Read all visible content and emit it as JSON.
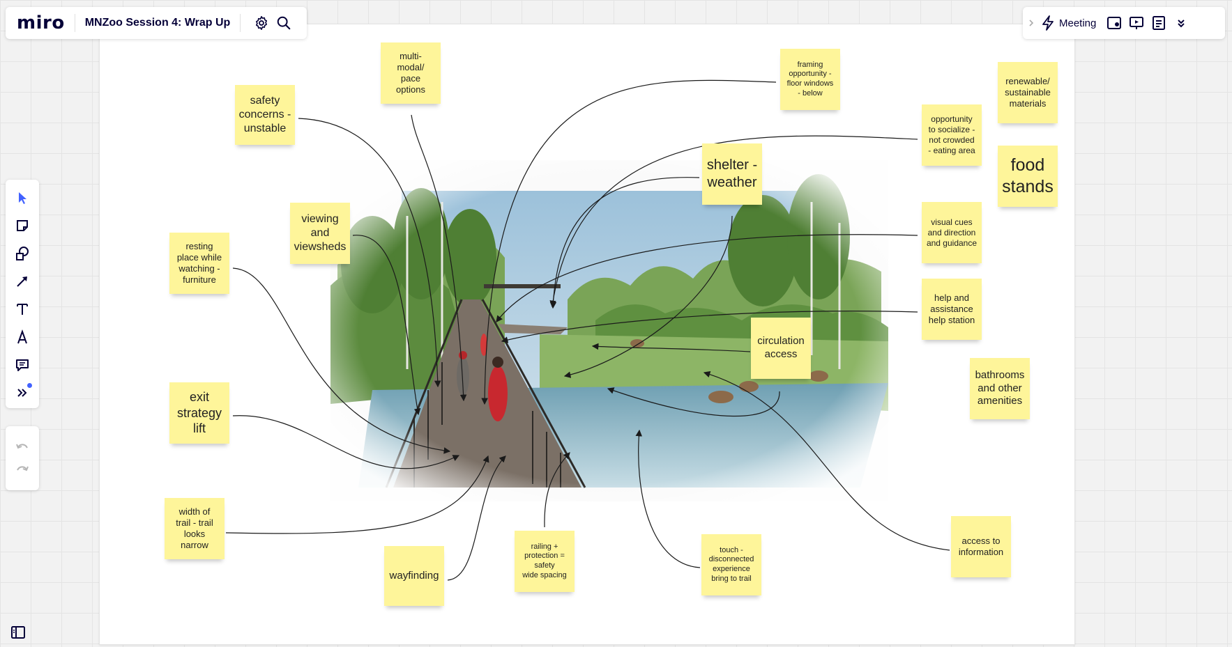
{
  "app": {
    "logo": "miro",
    "board_title": "MNZoo Session 4: Wrap Up"
  },
  "topbar": {
    "meeting_label": "Meeting"
  },
  "toolbar": {
    "tools": [
      "select-tool",
      "sticky-note-tool",
      "shapes-tool",
      "connection-line-tool",
      "text-tool",
      "pen-tool",
      "comment-tool",
      "more-tools"
    ],
    "accent": "#4262ff"
  },
  "stickies": {
    "multi_modal": "multi-\nmodal/\npace\noptions",
    "safety": "safety\nconcerns -\nunstable",
    "framing": "framing\nopportunity -\nfloor windows\n- below",
    "renewable": "renewable/\nsustainable\nmaterials",
    "socialize": "opportunity\nto socialize -\nnot crowded\n- eating area",
    "shelter": "shelter -\nweather",
    "food": "food\nstands",
    "viewing": "viewing\nand\nviewsheds",
    "resting": "resting\nplace while\nwatching -\nfurniture",
    "visual_cues": "visual cues\nand direction\nand guidance",
    "help": "help and\nassistance\nhelp station",
    "circulation": "circulation\naccess",
    "bathrooms": "bathrooms\nand other\namenities",
    "exit": "exit\nstrategy\nlift",
    "width": "width of\ntrail - trail\nlooks\nnarrow",
    "wayfinding": "wayfinding",
    "railing": "railing +\nprotection =\nsafety\nwide spacing",
    "touch": "touch -\ndisconnected\nexperience\nbring to trail",
    "access_info": "access to\ninformation"
  },
  "colors": {
    "sticky": "#fef59a",
    "brand_text": "#050038"
  }
}
